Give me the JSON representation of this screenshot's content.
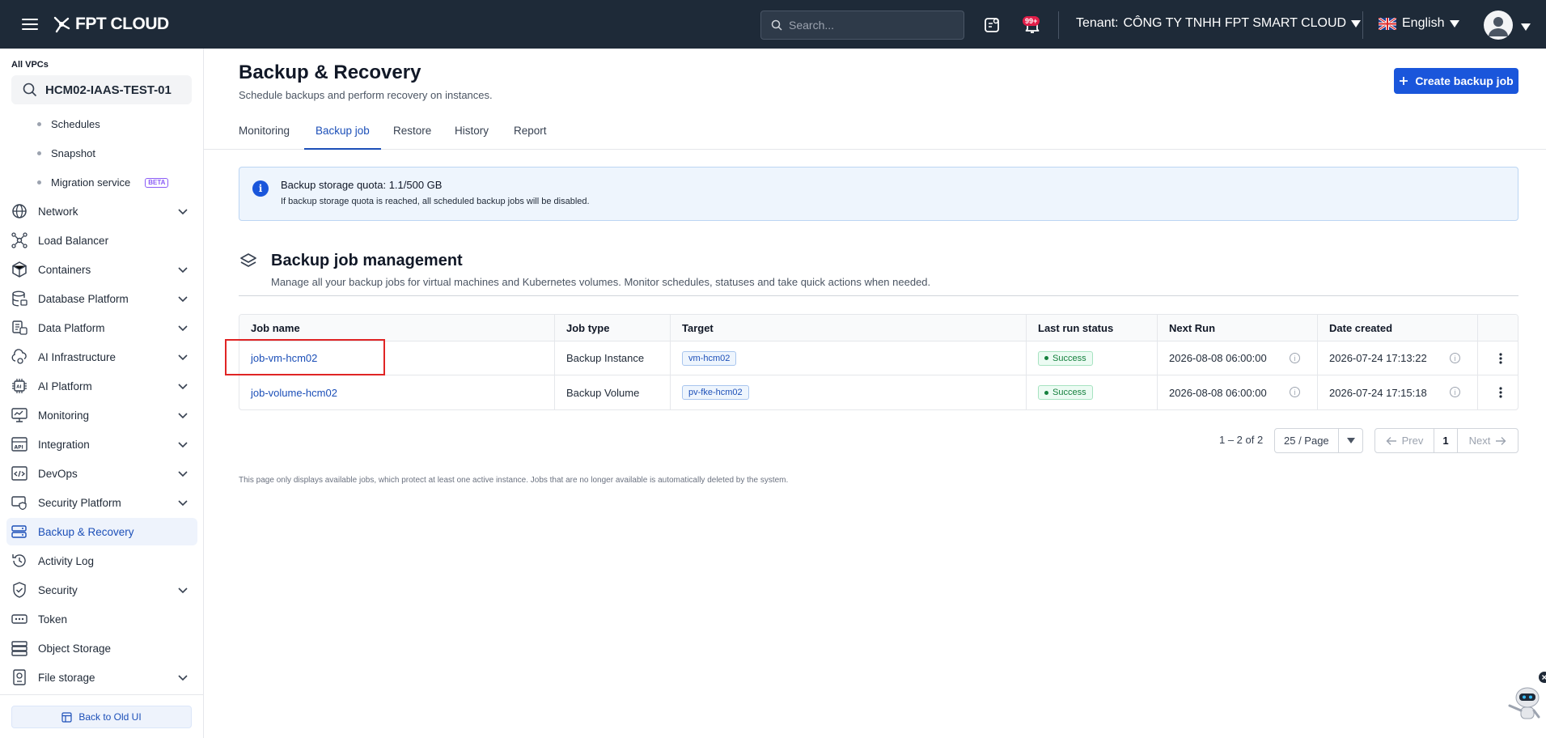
{
  "topbar": {
    "brand": "FPT CLOUD",
    "search_placeholder": "Search...",
    "notification_badge": "99+",
    "tenant_label": "Tenant:",
    "tenant_name": "CÔNG TY TNHH FPT SMART CLOUD",
    "language": "English"
  },
  "sidebar": {
    "vpc_label": "All VPCs",
    "vpc_value": "HCM02-IAAS-TEST-01",
    "sub_items": [
      "Schedules",
      "Snapshot",
      "Migration service"
    ],
    "beta_badge": "BETA",
    "items": [
      {
        "label": "Network",
        "expandable": true
      },
      {
        "label": "Load Balancer",
        "expandable": false
      },
      {
        "label": "Containers",
        "expandable": true
      },
      {
        "label": "Database Platform",
        "expandable": true
      },
      {
        "label": "Data Platform",
        "expandable": true
      },
      {
        "label": "AI Infrastructure",
        "expandable": true
      },
      {
        "label": "AI Platform",
        "expandable": true
      },
      {
        "label": "Monitoring",
        "expandable": true
      },
      {
        "label": "Integration",
        "expandable": true
      },
      {
        "label": "DevOps",
        "expandable": true
      },
      {
        "label": "Security Platform",
        "expandable": true
      },
      {
        "label": "Backup & Recovery",
        "expandable": false,
        "active": true
      },
      {
        "label": "Activity Log",
        "expandable": false
      },
      {
        "label": "Security",
        "expandable": true
      },
      {
        "label": "Token",
        "expandable": false
      },
      {
        "label": "Object Storage",
        "expandable": false
      },
      {
        "label": "File storage",
        "expandable": true
      }
    ],
    "back_button": "Back to Old UI"
  },
  "main": {
    "title": "Backup & Recovery",
    "subtitle": "Schedule backups and perform recovery on instances.",
    "create_button": "Create backup job",
    "tabs": [
      "Monitoring",
      "Backup job",
      "Restore",
      "History",
      "Report"
    ],
    "active_tab": "Backup job",
    "quota": {
      "title": "Backup storage quota: 1.1/500 GB",
      "description": "If backup storage quota is reached, all scheduled backup jobs will be disabled."
    },
    "section_title": "Backup job management",
    "section_subtitle": "Manage all your backup jobs for virtual machines and Kubernetes volumes. Monitor schedules, statuses and take quick actions when needed.",
    "table": {
      "columns": [
        "Job name",
        "Job type",
        "Target",
        "Last run status",
        "Next Run",
        "Date created"
      ],
      "rows": [
        {
          "job_name": "job-vm-hcm02",
          "job_type": "Backup Instance",
          "target": "vm-hcm02",
          "status": "Success",
          "next_run": "2026-08-08 06:00:00",
          "date_created": "2026-07-24 17:13:22"
        },
        {
          "job_name": "job-volume-hcm02",
          "job_type": "Backup Volume",
          "target": "pv-fke-hcm02",
          "status": "Success",
          "next_run": "2026-08-08 06:00:00",
          "date_created": "2026-07-24 17:15:18"
        }
      ]
    },
    "pagination": {
      "count": "1 – 2 of 2",
      "page_size": "25 / Page",
      "prev": "Prev",
      "page": "1",
      "next": "Next"
    },
    "footnote": "This page only displays available jobs, which protect at least one active instance. Jobs that are no longer available is automatically deleted by the system."
  },
  "colors": {
    "topbar_bg": "#1e2a38",
    "primary": "#1a56db",
    "highlight": "#e02424",
    "success": "#15803d"
  }
}
